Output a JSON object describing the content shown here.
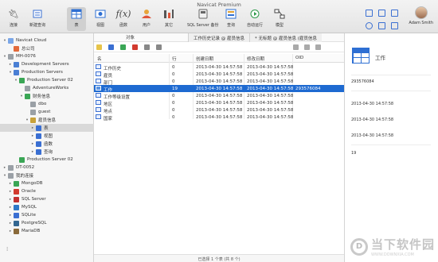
{
  "window": {
    "title": "Navicat Premium"
  },
  "toolbar": {
    "items": [
      {
        "label": "连接",
        "icon": "connection-icon"
      },
      {
        "label": "新建查询",
        "icon": "new-query-icon"
      },
      {
        "label": "表",
        "icon": "table-icon"
      },
      {
        "label": "视图",
        "icon": "view-icon"
      },
      {
        "label": "函数",
        "icon": "function-icon"
      },
      {
        "label": "用户",
        "icon": "user-icon"
      },
      {
        "label": "其它",
        "icon": "others-icon"
      },
      {
        "label": "SQL Server 备份",
        "icon": "backup-icon"
      },
      {
        "label": "查询",
        "icon": "query-icon"
      },
      {
        "label": "自动运行",
        "icon": "automation-icon"
      },
      {
        "label": "模型",
        "icon": "model-icon"
      }
    ],
    "user_name": "Adam Smith"
  },
  "sidebar": {
    "items": [
      {
        "label": "Navicat Cloud",
        "depth": 0,
        "arrow": "▾",
        "color": "#7aa6e8"
      },
      {
        "label": "总公司",
        "depth": 1,
        "arrow": "",
        "color": "#e26a3b"
      },
      {
        "label": "MH-0076",
        "depth": 0,
        "arrow": "▾",
        "color": "#9aa0a6"
      },
      {
        "label": "Development Servers",
        "depth": 1,
        "arrow": "▸",
        "color": "#4a7fd4"
      },
      {
        "label": "Production Servers",
        "depth": 1,
        "arrow": "▾",
        "color": "#4a7fd4"
      },
      {
        "label": "Production Server 02",
        "depth": 2,
        "arrow": "▾",
        "color": "#3aa655"
      },
      {
        "label": "AdventureWorks",
        "depth": 3,
        "arrow": "",
        "color": "#9aa0a6"
      },
      {
        "label": "财务信息",
        "depth": 3,
        "arrow": "▾",
        "color": "#3aa655"
      },
      {
        "label": "dbo",
        "depth": 4,
        "arrow": "",
        "color": "#9aa0a6"
      },
      {
        "label": "guest",
        "depth": 4,
        "arrow": "",
        "color": "#9aa0a6"
      },
      {
        "label": "雇员信息",
        "depth": 4,
        "arrow": "▾",
        "color": "#c9a23a"
      },
      {
        "label": "表",
        "depth": 5,
        "arrow": "▸",
        "color": "#3a6fd2"
      },
      {
        "label": "视图",
        "depth": 5,
        "arrow": "▸",
        "color": "#3a6fd2"
      },
      {
        "label": "函数",
        "depth": 5,
        "arrow": "▸",
        "color": "#3a6fd2"
      },
      {
        "label": "查询",
        "depth": 5,
        "arrow": "▸",
        "color": "#3a6fd2"
      },
      {
        "label": "Production Server 02",
        "depth": 2,
        "arrow": "",
        "color": "#3aa655"
      },
      {
        "label": "DT-0052",
        "depth": 0,
        "arrow": "▸",
        "color": "#9aa0a6"
      },
      {
        "label": "我的连接",
        "depth": 0,
        "arrow": "▾",
        "color": "#9aa0a6"
      },
      {
        "label": "MongoDB",
        "depth": 1,
        "arrow": "▸",
        "color": "#3aa655"
      },
      {
        "label": "Oracle",
        "depth": 1,
        "arrow": "▸",
        "color": "#d23a2e"
      },
      {
        "label": "SQL Server",
        "depth": 1,
        "arrow": "▸",
        "color": "#c23030"
      },
      {
        "label": "MySQL",
        "depth": 1,
        "arrow": "▸",
        "color": "#2e78c7"
      },
      {
        "label": "SQLite",
        "depth": 1,
        "arrow": "▸",
        "color": "#3a6fd2"
      },
      {
        "label": "PostgreSQL",
        "depth": 1,
        "arrow": "▸",
        "color": "#336791"
      },
      {
        "label": "MariaDB",
        "depth": 1,
        "arrow": "▸",
        "color": "#8a6a3a"
      }
    ]
  },
  "main": {
    "objects_label": "对象",
    "tabs": [
      "工作历史记录 @ 雇员信息",
      "* 无标题 @ 雇员信息 (雇员信息"
    ],
    "columns": [
      "名",
      "行",
      "创建日期",
      "修改日期",
      "OID"
    ],
    "rows": [
      {
        "name": "工作历史",
        "rows": "0",
        "created": "2013-04-30 14:57:58",
        "modified": "2013-04-30 14:57:58",
        "oid": ""
      },
      {
        "name": "雇员",
        "rows": "0",
        "created": "2013-04-30 14:57:58",
        "modified": "2013-04-30 14:57:58",
        "oid": ""
      },
      {
        "name": "部门",
        "rows": "0",
        "created": "2013-04-30 14:57:58",
        "modified": "2013-04-30 14:57:58",
        "oid": ""
      },
      {
        "name": "工作",
        "rows": "19",
        "created": "2013-04-30 14:57:58",
        "modified": "2013-04-30 14:57:58",
        "oid": "293576084"
      },
      {
        "name": "工作等级设置",
        "rows": "0",
        "created": "2013-04-30 14:57:58",
        "modified": "2013-04-30 14:57:58",
        "oid": ""
      },
      {
        "name": "地区",
        "rows": "0",
        "created": "2013-04-30 14:57:58",
        "modified": "2013-04-30 14:57:58",
        "oid": ""
      },
      {
        "name": "地点",
        "rows": "0",
        "created": "2013-04-30 14:57:58",
        "modified": "2013-04-30 14:57:58",
        "oid": ""
      },
      {
        "name": "国家",
        "rows": "0",
        "created": "2013-04-30 14:57:58",
        "modified": "2013-04-30 14:57:58",
        "oid": ""
      }
    ],
    "selected_row": 3,
    "status": "已选择 1 个表 (共 8 个)"
  },
  "info": {
    "name": "工作",
    "entries": [
      "293576084",
      "2013-04-30 14:57:58",
      "2013-04-30 14:57:58",
      "2013-04-30 14:57:58",
      "19"
    ]
  },
  "watermark": {
    "text": "当下软件园",
    "url": "WWW.DOWNXIA.COM"
  },
  "colors": {
    "accent": "#1e6ad1",
    "selection_gray": "#d9d9d9"
  }
}
